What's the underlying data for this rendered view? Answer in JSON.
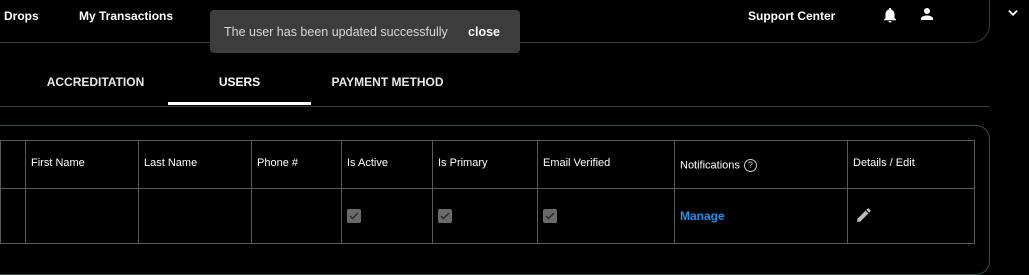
{
  "header": {
    "nav": [
      "Drops",
      "My Transactions"
    ],
    "support_label": "Support Center"
  },
  "toast": {
    "message": "The user has been updated successfully",
    "close_label": "close"
  },
  "tabs": [
    {
      "label": "ACCREDITATION",
      "active": false
    },
    {
      "label": "USERS",
      "active": true
    },
    {
      "label": "PAYMENT METHOD",
      "active": false
    }
  ],
  "table": {
    "headers": [
      "First Name",
      "Last Name",
      "Phone #",
      "Is Active",
      "Is Primary",
      "Email Verified",
      "Notifications",
      "Details / Edit"
    ],
    "row": {
      "first_name": "",
      "last_name": "",
      "phone": "",
      "is_active": true,
      "is_primary": true,
      "email_verified": true,
      "notifications_link": "Manage"
    }
  },
  "colors": {
    "accent_link": "#1e90e6",
    "panel_border": "#2e5448",
    "toast_bg": "#3c3c3c"
  },
  "icons": [
    "bell-icon",
    "user-icon",
    "chevron-down-icon",
    "help-circle-icon",
    "pencil-icon",
    "check-icon"
  ]
}
